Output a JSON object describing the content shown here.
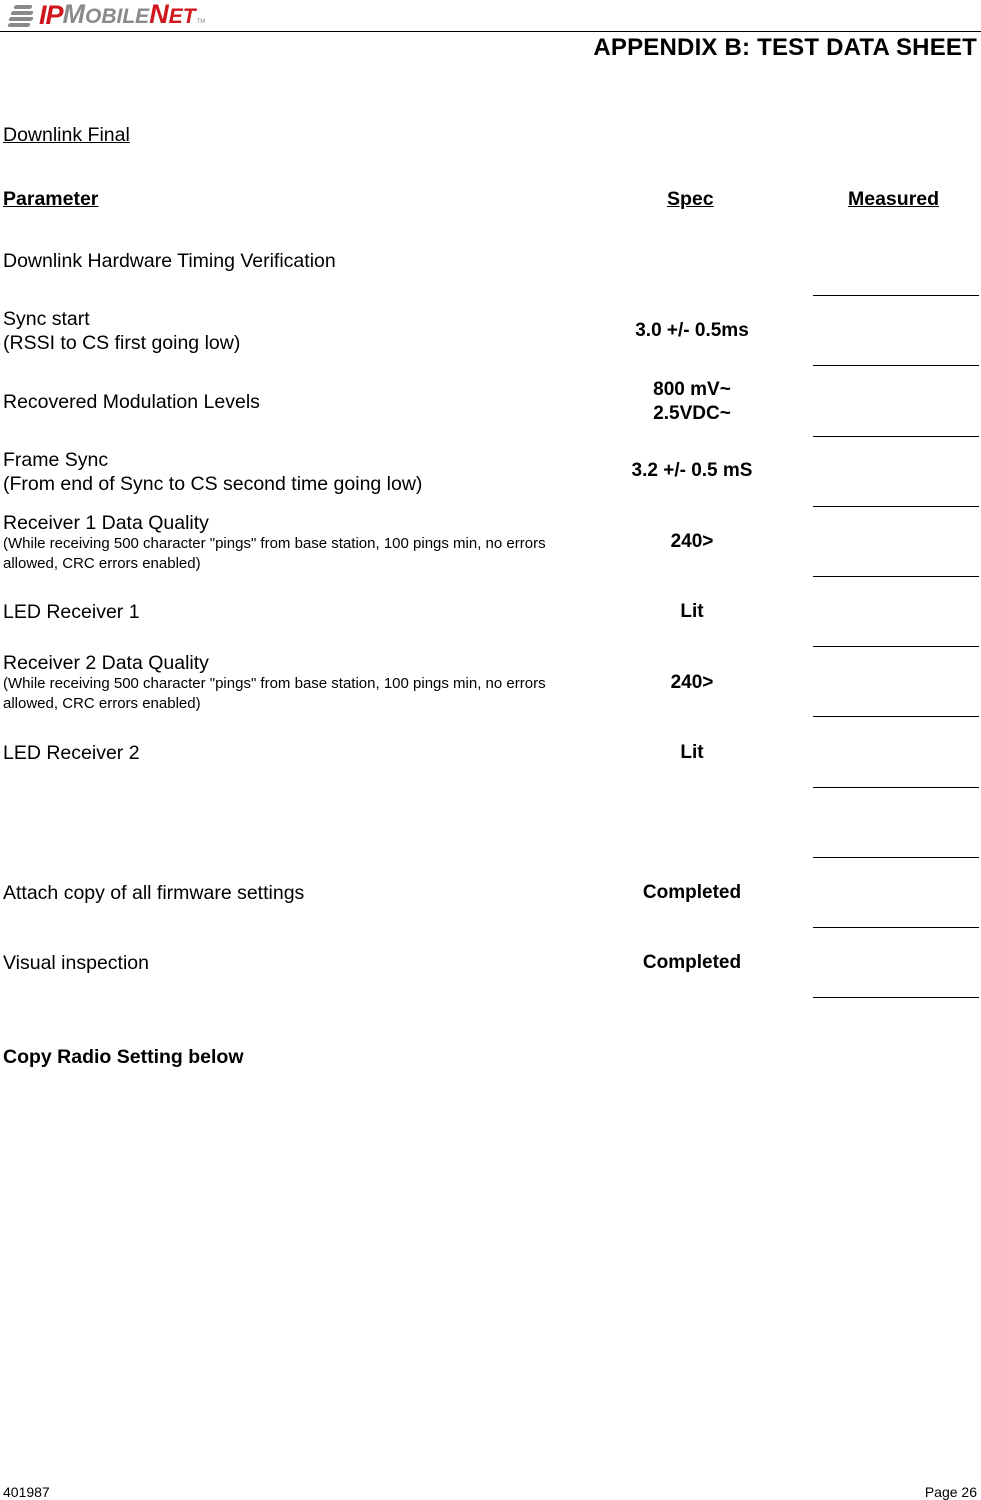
{
  "header": {
    "logo": {
      "ip": "IP",
      "mobile": "MOBILE",
      "net": "NET",
      "tm": "TM",
      "brand_red": "#d0161c",
      "brand_gray": "#8a8a8a"
    },
    "title": "APPENDIX B:  TEST DATA SHEET"
  },
  "section": {
    "title": "Downlink Final"
  },
  "columns": {
    "parameter": "Parameter",
    "spec": "Spec",
    "measured": "Measured"
  },
  "subsection": "Downlink Hardware Timing Verification",
  "rows": [
    {
      "parameter": "Sync start",
      "detail": "(RSSI to CS first going low)",
      "spec": "3.0 +/- 0.5ms",
      "measured": ""
    },
    {
      "parameter": "Recovered Modulation Levels",
      "spec_line1": "800 mV~",
      "spec_line2": "2.5VDC~",
      "measured": ""
    },
    {
      "parameter": "Frame Sync",
      "detail": "(From end of Sync to CS second time going low)",
      "spec": "3.2 +/- 0.5 mS",
      "measured": ""
    },
    {
      "parameter": "Receiver 1  Data Quality",
      "note": "(While receiving 500 character \"pings\" from base station, 100 pings min, no errors allowed, CRC errors enabled)",
      "spec": "240>",
      "measured": ""
    },
    {
      "parameter": "LED Receiver 1",
      "spec": "Lit",
      "measured": ""
    },
    {
      "parameter": "Receiver 2 Data Quality",
      "note": "(While receiving 500 character \"pings\" from base station, 100 pings min, no errors allowed, CRC errors enabled)",
      "spec": "240>",
      "measured": ""
    },
    {
      "parameter": "LED Receiver 2",
      "spec": "Lit",
      "measured": ""
    },
    {
      "parameter": "",
      "spec": "",
      "measured": ""
    },
    {
      "parameter": "Attach copy of all firmware settings",
      "spec": "Completed",
      "measured": ""
    },
    {
      "parameter": "Visual inspection",
      "spec": "Completed",
      "measured": ""
    }
  ],
  "copy_label": "Copy Radio Setting below",
  "footer": {
    "doc_number": "401987",
    "page": "Page 26"
  }
}
